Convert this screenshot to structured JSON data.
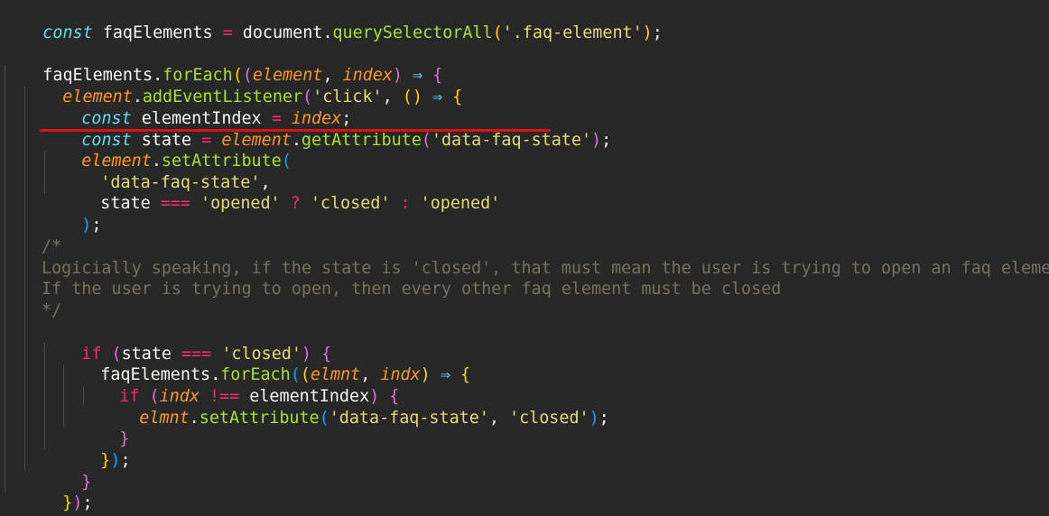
{
  "colors": {
    "background": "#272727",
    "keyword": "#66d9ef",
    "function": "#a6e22e",
    "string": "#e6db74",
    "parameter": "#fd971f",
    "operator": "#f92672",
    "comment": "#75715e",
    "highlight_underline": "#e01010"
  },
  "code": {
    "l1": {
      "kw": "const",
      "name": " faqElements ",
      "op": "=",
      "rest1": " document.",
      "fn": "querySelectorAll",
      "p1": "(",
      "str": "'.faq-element'",
      "p2": ")",
      "end": ";"
    },
    "l3": {
      "name": "faqElements.",
      "fn": "forEach",
      "p1": "(",
      "p2": "(",
      "a1": "element",
      "comma": ", ",
      "a2": "index",
      "p3": ")",
      "arrow": " ⇒ ",
      "brace": "{"
    },
    "l4": {
      "obj": "element",
      "dot": ".",
      "fn": "addEventListener",
      "p1": "(",
      "str": "'click'",
      "comma": ", ",
      "p2": "()",
      "arrow": " ⇒ ",
      "brace": "{"
    },
    "l5": {
      "kw": "const",
      "name": " elementIndex ",
      "op": "=",
      "val": " index",
      "end": ";"
    },
    "l6": {
      "kw": "const",
      "name": " state ",
      "op": "=",
      "obj": " element",
      "dot": ".",
      "fn": "getAttribute",
      "p1": "(",
      "str": "'data-faq-state'",
      "p2": ")",
      "end": ";"
    },
    "l7": {
      "obj": "element",
      "dot": ".",
      "fn": "setAttribute",
      "p1": "("
    },
    "l8": {
      "str": "'data-faq-state'",
      "end": ","
    },
    "l9": {
      "name": "state ",
      "op": "===",
      "s1": " 'opened'",
      "q": " ?",
      "s2": " 'closed'",
      "c": " :",
      "s3": " 'opened'"
    },
    "l10": {
      "p": ")",
      "end": ";"
    },
    "l12": "/*",
    "l13": "Logicially speaking, if the state is 'closed', that must mean the user is trying to open an faq element",
    "l14": "If the user is trying to open, then every other faq element must be closed",
    "l15": "*/",
    "l16": {
      "kw": "if",
      "p1": " (",
      "name": "state ",
      "op": "===",
      "str": " 'closed'",
      "p2": ")",
      "brace": " {"
    },
    "l17": {
      "name": "faqElements.",
      "fn": "forEach",
      "p1": "(",
      "p2": "(",
      "a1": "elmnt",
      "comma": ", ",
      "a2": "indx",
      "p3": ")",
      "arrow": " ⇒ ",
      "brace": "{"
    },
    "l18": {
      "kw": "if",
      "p1": " (",
      "a": "indx",
      "op": " !==",
      "name": " elementIndex",
      "p2": ")",
      "brace": " {"
    },
    "l19": {
      "obj": "elmnt",
      "dot": ".",
      "fn": "setAttribute",
      "p1": "(",
      "s1": "'data-faq-state'",
      "comma": ", ",
      "s2": "'closed'",
      "p2": ")",
      "end": ";"
    },
    "l20": "}",
    "l21": {
      "b": "}",
      "p": ")",
      "end": ";"
    },
    "l22": "}",
    "l23": {
      "b": "}",
      "p": ")",
      "end": ";"
    },
    "l24": {
      "b": "}",
      "p": ")",
      "end": ";"
    }
  }
}
